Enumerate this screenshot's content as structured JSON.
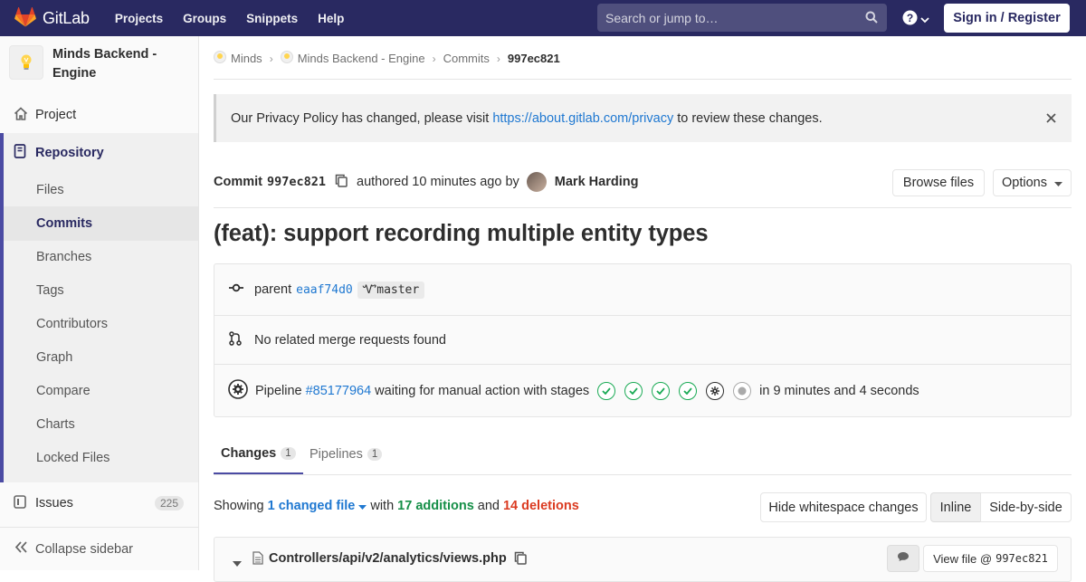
{
  "nav": {
    "brand": "GitLab",
    "links": [
      "Projects",
      "Groups",
      "Snippets",
      "Help"
    ],
    "search_placeholder": "Search or jump to…",
    "signin": "Sign in / Register",
    "colors": {
      "bar": "#292961",
      "accent": "#4b4ba3",
      "link": "#1f78d1"
    }
  },
  "sidebar": {
    "project_name": "Minds Backend - Engine",
    "project": "Project",
    "repository": "Repository",
    "repo_items": [
      "Files",
      "Commits",
      "Branches",
      "Tags",
      "Contributors",
      "Graph",
      "Compare",
      "Charts",
      "Locked Files"
    ],
    "active_item": "Commits",
    "issues": "Issues",
    "issues_count": "225",
    "collapse": "Collapse sidebar"
  },
  "breadcrumb": {
    "items": [
      "Minds",
      "Minds Backend - Engine",
      "Commits"
    ],
    "current": "997ec821"
  },
  "alert": {
    "text_before": "Our Privacy Policy has changed, please visit",
    "link": "https://about.gitlab.com/privacy",
    "text_after": "to review these changes."
  },
  "commit": {
    "label": "Commit",
    "sha": "997ec821",
    "authored": "authored 10 minutes ago by",
    "author": "Mark Harding",
    "browse_files": "Browse files",
    "options": "Options",
    "title": "(feat): support recording multiple entity types",
    "parent_label": "parent",
    "parent_sha": "eaaf74d0",
    "branch": "master",
    "no_mr": "No related merge requests found",
    "pipeline_label": "Pipeline",
    "pipeline_id": "#85177964",
    "pipeline_status": "waiting for manual action with stages",
    "stages": [
      "passed",
      "passed",
      "passed",
      "passed",
      "manual",
      "skipped"
    ],
    "duration": "in 9 minutes and 4 seconds"
  },
  "tabs": [
    {
      "label": "Changes",
      "count": "1",
      "active": true
    },
    {
      "label": "Pipelines",
      "count": "1",
      "active": false
    }
  ],
  "diff": {
    "showing": "Showing",
    "changed": "1 changed file",
    "with": "with",
    "additions": "17 additions",
    "and": "and",
    "deletions": "14 deletions",
    "hide_ws": "Hide whitespace changes",
    "inline": "Inline",
    "side_by_side": "Side-by-side",
    "file_path": "Controllers/api/v2/analytics/views.php",
    "view_file": "View file @",
    "view_file_sha": "997ec821"
  }
}
